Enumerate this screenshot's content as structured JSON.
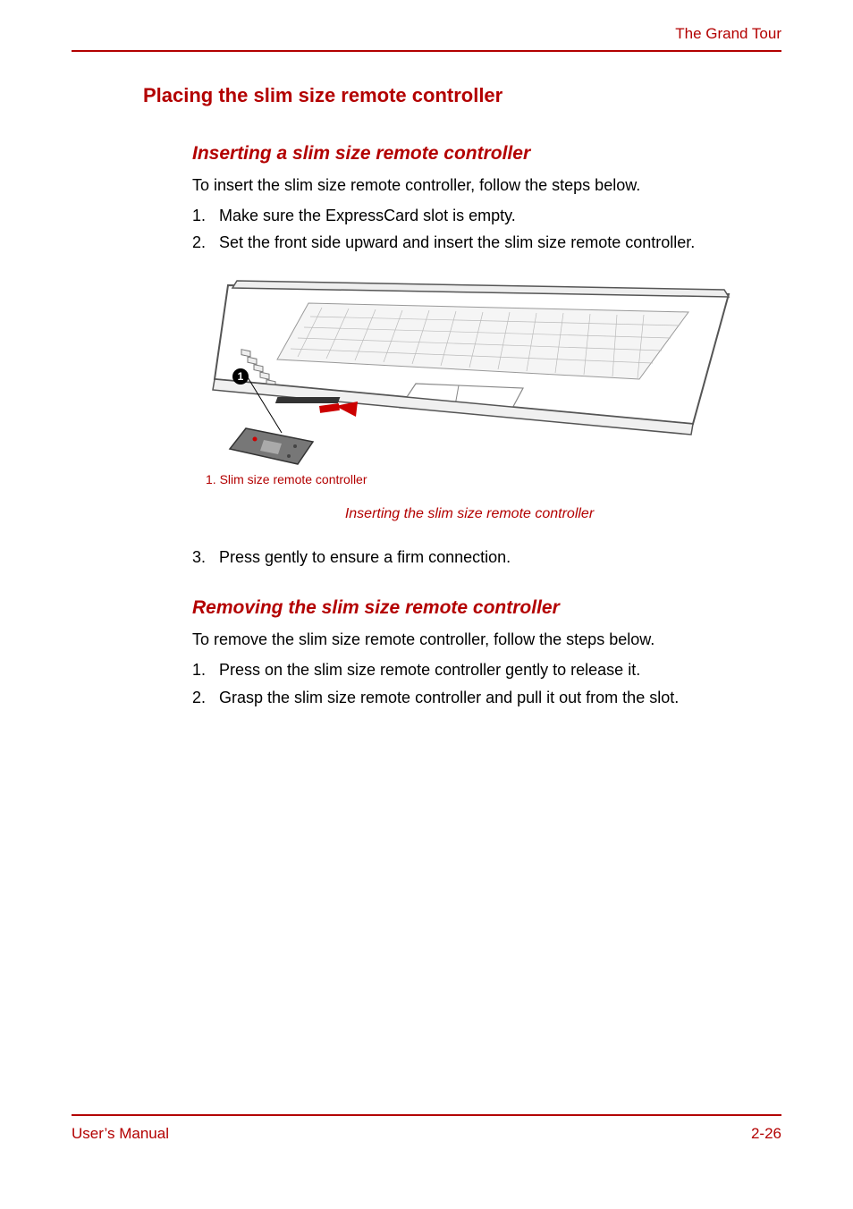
{
  "header": {
    "chapter": "The Grand Tour"
  },
  "section": {
    "title": "Placing the slim size remote controller"
  },
  "inserting": {
    "title": "Inserting a slim size remote controller",
    "intro": "To insert the slim size remote controller, follow the steps below.",
    "step1_num": "1.",
    "step1_text": "Make sure the ExpressCard slot is empty.",
    "step2_num": "2.",
    "step2_text": "Set the front side upward and insert the slim size remote controller.",
    "step3_num": "3.",
    "step3_text": "Press gently to ensure a firm connection."
  },
  "figure": {
    "callout_number": "1",
    "legend": "1. Slim size remote controller",
    "caption": "Inserting the slim size remote controller"
  },
  "removing": {
    "title": "Removing the slim size remote controller",
    "intro": "To remove the slim size remote controller, follow the steps below.",
    "step1_num": "1.",
    "step1_text": "Press on the slim size remote controller gently to release it.",
    "step2_num": "2.",
    "step2_text": "Grasp the slim size remote controller and pull it out from the slot."
  },
  "footer": {
    "left": "User’s Manual",
    "right": "2-26"
  }
}
